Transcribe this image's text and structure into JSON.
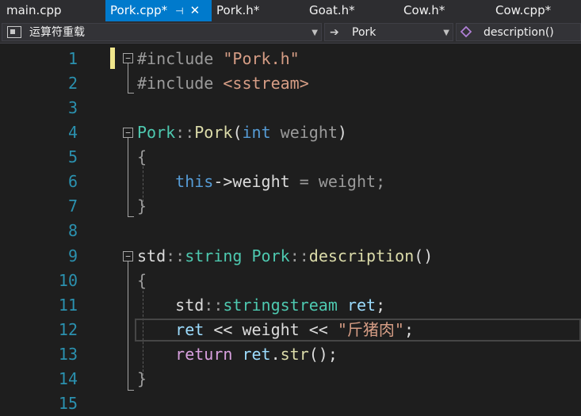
{
  "tabs": [
    {
      "label": "main.cpp",
      "active": false
    },
    {
      "label": "Pork.cpp*",
      "active": true
    },
    {
      "label": "Pork.h*",
      "active": false
    },
    {
      "label": "Goat.h*",
      "active": false
    },
    {
      "label": "Cow.h*",
      "active": false
    },
    {
      "label": "Cow.cpp*",
      "active": false
    }
  ],
  "navbar": {
    "project": "运算符重载",
    "scope": "Pork",
    "member": "description()"
  },
  "lines": [
    {
      "num": "1",
      "text": "#include \"Pork.h\""
    },
    {
      "num": "2",
      "text": "#include <sstream>"
    },
    {
      "num": "3",
      "text": ""
    },
    {
      "num": "4",
      "text": "Pork::Pork(int weight)"
    },
    {
      "num": "5",
      "text": "{"
    },
    {
      "num": "6",
      "text": "    this->weight = weight;"
    },
    {
      "num": "7",
      "text": "}"
    },
    {
      "num": "8",
      "text": ""
    },
    {
      "num": "9",
      "text": "std::string Pork::description()"
    },
    {
      "num": "10",
      "text": "{"
    },
    {
      "num": "11",
      "text": "    std::stringstream ret;"
    },
    {
      "num": "12",
      "text": "    ret << weight << \"斤猪肉\";"
    },
    {
      "num": "13",
      "text": "    return ret.str();"
    },
    {
      "num": "14",
      "text": "}"
    },
    {
      "num": "15",
      "text": ""
    }
  ],
  "colors": {
    "accent": "#007acc",
    "keyword": "#569cd6",
    "type": "#4ec9b0",
    "function": "#dcdcaa",
    "string": "#d69d85",
    "line_number": "#2b91af"
  },
  "icons": [
    "project-icon",
    "scope-arrow-icon",
    "member-cube-icon",
    "pin-icon",
    "close-icon"
  ]
}
